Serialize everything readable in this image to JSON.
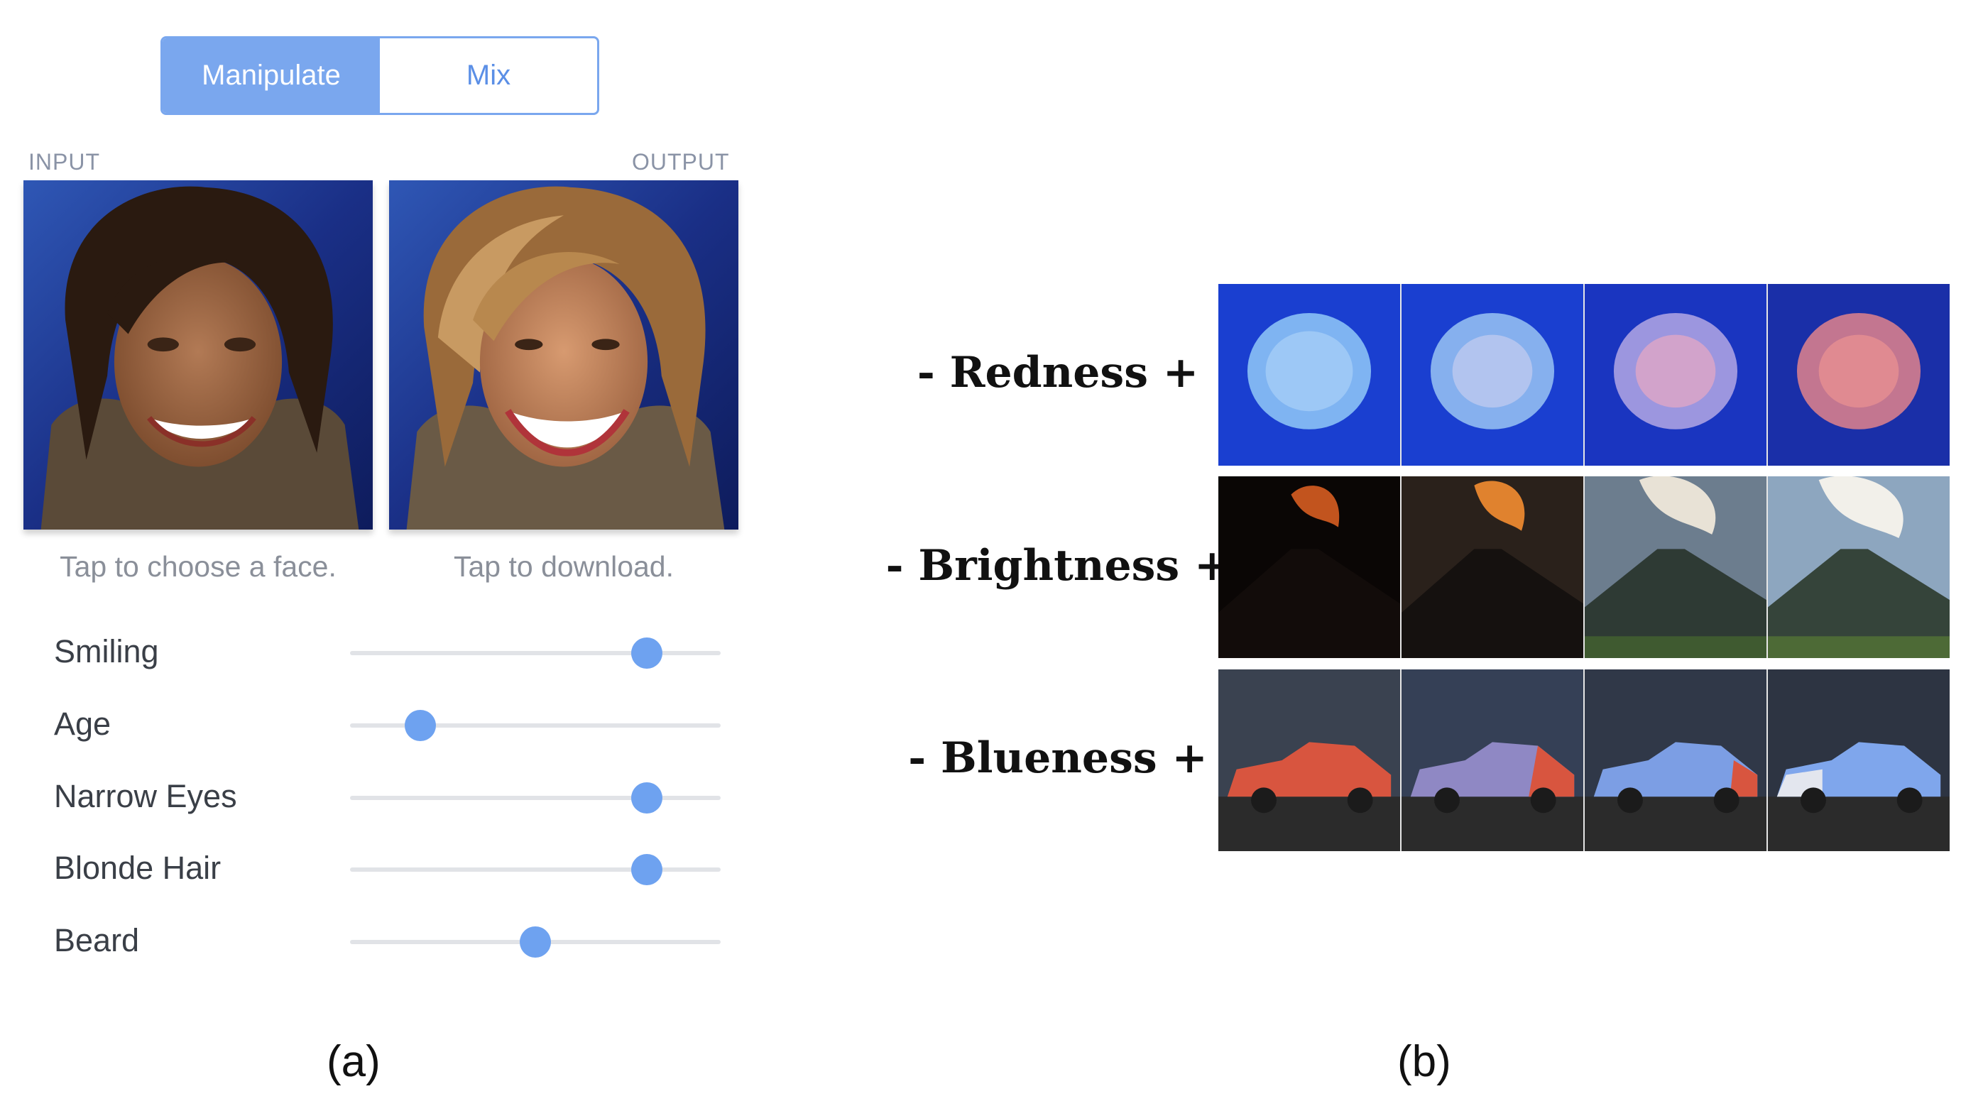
{
  "tabs": {
    "manipulate": "Manipulate",
    "mix": "Mix",
    "active": "manipulate"
  },
  "labels": {
    "input": "INPUT",
    "output": "OUTPUT"
  },
  "hints": {
    "input": "Tap to choose a face.",
    "output": "Tap to download."
  },
  "sliders": [
    {
      "label": "Smiling",
      "value": 0.8
    },
    {
      "label": "Age",
      "value": 0.19
    },
    {
      "label": "Narrow Eyes",
      "value": 0.8
    },
    {
      "label": "Blonde Hair",
      "value": 0.8
    },
    {
      "label": "Beard",
      "value": 0.5
    }
  ],
  "panel_tags": {
    "a": "(a)",
    "b": "(b)"
  },
  "rows": {
    "redness": "- Redness +",
    "brightness": "- Brightness +",
    "blueness": "- Blueness +"
  },
  "colors": {
    "accent": "#7aa7ee",
    "thumb": "#6ea2f0"
  }
}
